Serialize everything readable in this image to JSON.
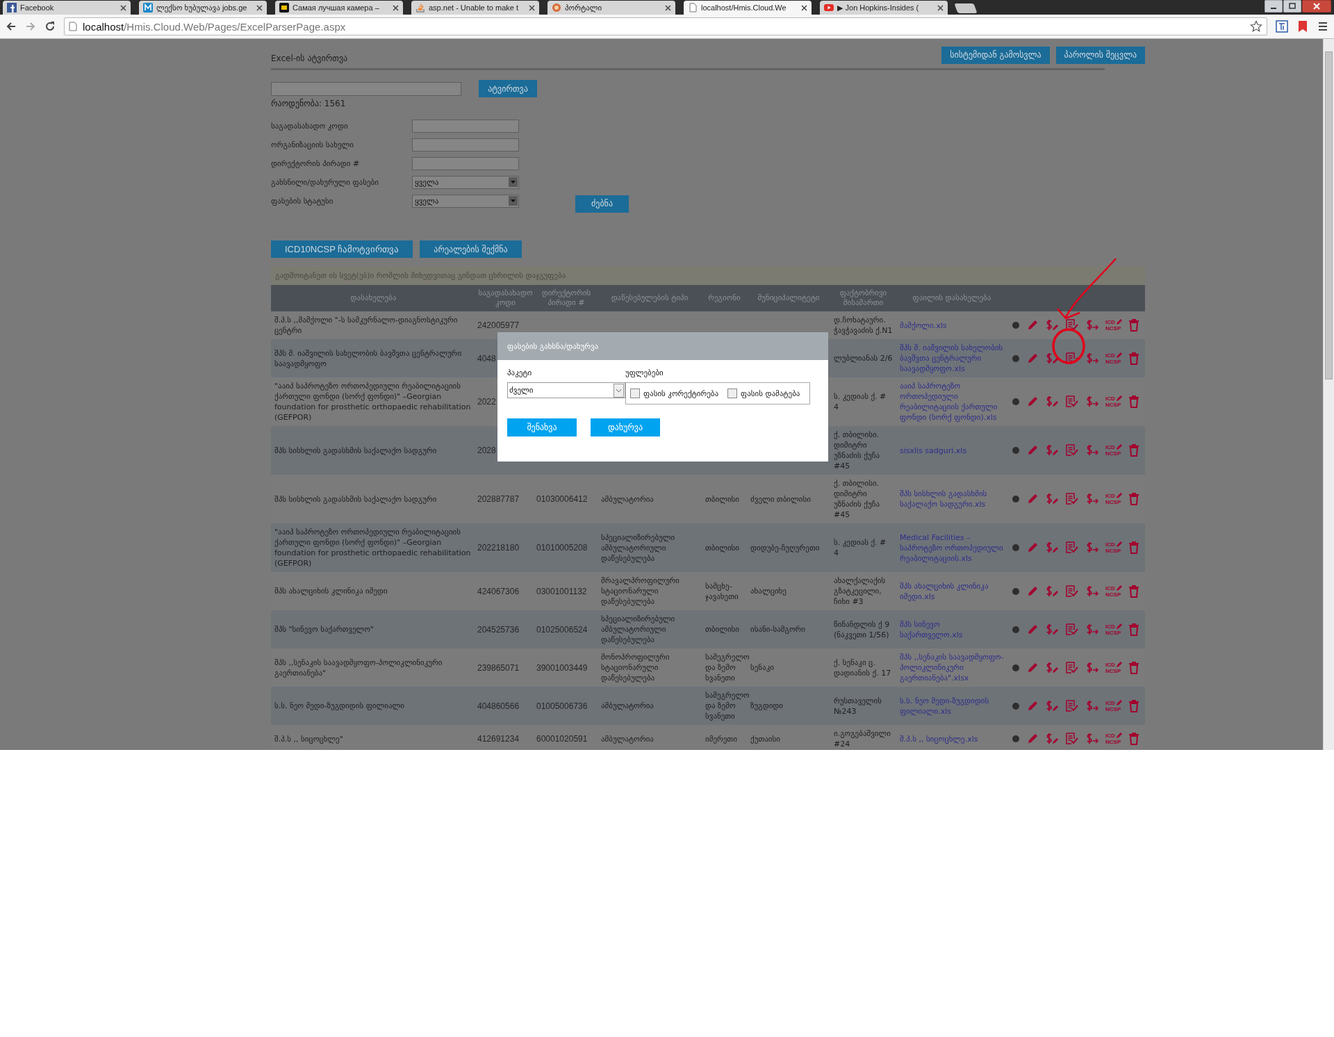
{
  "browser": {
    "tabs": [
      {
        "title": "Facebook",
        "kind": "facebook",
        "selected": false
      },
      {
        "title": "ლექსო ხუბულავა jobs.ge",
        "kind": "m",
        "selected": false
      },
      {
        "title": "Самая лучшая камера –",
        "kind": "ad",
        "selected": false
      },
      {
        "title": "asp.net - Unable to make t",
        "kind": "stack",
        "selected": false
      },
      {
        "title": "პორტალი",
        "kind": "portal",
        "selected": false
      },
      {
        "title": "localhost/Hmis.Cloud.We",
        "kind": "page",
        "selected": true
      },
      {
        "title": "▶ Jon Hopkins-Insides (",
        "kind": "youtube",
        "selected": false
      }
    ],
    "address": {
      "host": "localhost",
      "path": "/Hmis.Cloud.Web/Pages/ExcelParserPage.aspx"
    }
  },
  "header": {
    "title": "Excel-ის ატვირთვა",
    "buttons": [
      "სისტემიდან გამოსვლა",
      "პაროლის შეცვლა"
    ]
  },
  "upload": {
    "button": "ატვირთვა",
    "count": "რაოდენობა: 1561"
  },
  "filters": [
    {
      "kind": "text",
      "label": "საგადასახადო კოდი"
    },
    {
      "kind": "text",
      "label": "ორგანიზაციის სახელი"
    },
    {
      "kind": "text",
      "label": "დირექტორის პირადი #"
    },
    {
      "kind": "select",
      "label": "გახსნილი/დახურული ფასები",
      "value": "ყველა"
    },
    {
      "kind": "select",
      "label": "ფასების სტატუსი",
      "value": "ყველა"
    }
  ],
  "search_button": "ძებნა",
  "actions": [
    "ICD10NCSP ჩამოტვირთვა",
    "არეალების შექმნა"
  ],
  "group_hint": "გადმოიტანეთ ის სვეტ(ებ)ი რომლის მიხედვითაც გინდათ ცხრილის დაჯგუფება",
  "table": {
    "columns": [
      "დასახელება",
      "საგადასახადო კოდი",
      "დირექტორის პირადი #",
      "დაწესებულების ტიპი",
      "რეგიონი",
      "მუნიციპალიტეტი",
      "ფაქტობრივი მისამართი",
      "ფაილის დასახელება"
    ],
    "rows": [
      {
        "name": "შ.პ.ს ,,მამქოლი \"-ს სამკურნალო-დიაგნოსტიკური ცენტრი",
        "tax_code": "242005977",
        "address": "დ.ჩოხატაური. ჭავჭავაძის ქ.N1",
        "file": "მამქოლი.xls",
        "icd": "ICD",
        "ncsp": "NCSP"
      },
      {
        "name": "შპს მ. იაშვილის სახელობის ბავშვთა ცენტრალური საავადმყოფო",
        "tax_code": "4048",
        "address": "ლუბლიანას 2/6",
        "file": "შპს მ. იაშვილის სახელობის ბავშვთა ცენტრალური საავადმყოფო.xls",
        "icd": "ICD",
        "ncsp": "NCSP"
      },
      {
        "name": "\"ააიპ საპროტეზო ორთოპედიული რეაბილიტაციის ქართული ფონდი (სორქ ფონდი)\" –Georgian foundation for prosthetic orthopaedic rehabilitation (GEFPOR)",
        "tax_code": "2022",
        "address": "ს. კედიას ქ. # 4",
        "file": "ააიპ საპროტეზო ორთოპედიული რეაბილიტაციის ქართული ფონდი (სორქ ფონდი).xls",
        "icd": "ICD",
        "ncsp": "NCSP"
      },
      {
        "name": "შპს სისხლის გადასხმის საქალაქო სადგური",
        "tax_code": "2028",
        "address": "ქ. თბილისი. დიმიტრი უზნაძის ქუჩა #45",
        "file": "sisxlis sadguri.xls",
        "icd": "ICD",
        "ncsp": "NCSP"
      },
      {
        "name": "შპს სისხლის გადასხმის საქალაქო სადგური",
        "tax_code": "202887787",
        "director_id": "01030006412",
        "type": "ამბულატორია",
        "region": "თბილისი",
        "municipality": "ძველი თბილისი",
        "address": "ქ. თბილისი. დიმიტრი უზნაძის ქუჩა #45",
        "file": "შპს სისხლის გადასხმის საქალაქო სადგური.xls",
        "icd": "ICD",
        "ncsp": "NCSP"
      },
      {
        "name": "\"ააიპ საპროტეზო ორთოპედიული რეაბილიტაციის ქართული ფონდი (სორქ ფონდი)\" –Georgian foundation for prosthetic orthopaedic rehabilitation (GEFPOR)",
        "tax_code": "202218180",
        "director_id": "01010005208",
        "type": "სპეციალიზირებული ამბულატორიული დაწესებულება",
        "region": "თბილისი",
        "municipality": "დიდუბე-ჩუღურეთი",
        "address": "ს. კედიას ქ. # 4",
        "file": "Medical Facilities – საპროტეზო ორთოპედიული რეაბილიტაციის.xls",
        "icd": "ICD",
        "ncsp": "NCSP"
      },
      {
        "name": "შპს ახალციხის კლინიკა იმედი",
        "tax_code": "424067306",
        "director_id": "03001001132",
        "type": "მრავალპროფილური სტაციონარული დაწესებულება",
        "region": "სამცხე-ჯავახეთი",
        "municipality": "ახალციხე",
        "address": "ახალქალაქის გზატკეცილი, ჩიხი #3",
        "file": "შპს ახალციხის კლინიკა იმედი.xls",
        "icd": "ICD",
        "ncsp": "NCSP"
      },
      {
        "name": "შპს \"სინევო საქართველო\"",
        "tax_code": "204525736",
        "director_id": "01025006524",
        "type": "სპეციალიზირებული ამბულატორიული დაწესებულება",
        "region": "თბილისი",
        "municipality": "ისანი-სამგორი",
        "address": "წინანდლის ქ 9 (ნაკვეთი 1/56)",
        "file": "შპს სინევო საქართველო.xls",
        "icd": "ICD",
        "ncsp": "NCSP"
      },
      {
        "name": "შპს ,,სენაკის საავადმყოფო-პოლიკლინიკური გაერთიანება\"",
        "tax_code": "239865071",
        "director_id": "39001003449",
        "type": "მონოპროფილური სტაციონარული დაწესებულება",
        "region": "სამეგრელო და ზემო სვანეთი",
        "municipality": "სენაკი",
        "address": "ქ. სენაკი ც. დადიანის ქ. 17",
        "file": "შპს ,,სენაკის საავადმყოფო-პოლიკლინიკური გაერთიანება\".xlsx",
        "icd": "ICD",
        "ncsp": "NCSP"
      },
      {
        "name": "ს.ს. ნეო მედი-ზუგდიდის ფილიალი",
        "tax_code": "404860566",
        "director_id": "01005006736",
        "type": "ამბულატორია",
        "region": "სამეგრელო და ზემო სვანეთი",
        "municipality": "ზუგდიდი",
        "address": "რუსთაველის №243",
        "file": "ს.ს. ნეო მედი-ზუგდიდის ფილიალი.xls",
        "icd": "ICD",
        "ncsp": "NCSP"
      },
      {
        "name": "შ.პ.ს ,, სიცოცხლე\"",
        "tax_code": "412691234",
        "director_id": "60001020591",
        "type": "ამბულატორია",
        "region": "იმერეთი",
        "municipality": "ქუთაისი",
        "address": "ი.გოგებაშვილი #24",
        "file": "შ.პ.ს ,, სიცოცხლე.xls",
        "icd": "ICD",
        "ncsp": "NCSP"
      }
    ]
  },
  "dialog": {
    "title": "ფასების გახსნა/დახურვა",
    "package_label": "პაკეტი",
    "package_value": "ძველი",
    "rights_label": "უფლებები",
    "rights": [
      {
        "label": "ფასის კორექტირება",
        "checked": false
      },
      {
        "label": "ფასის დამატება",
        "checked": false
      }
    ],
    "buttons": [
      "შენახვა",
      "დახურვა"
    ]
  }
}
